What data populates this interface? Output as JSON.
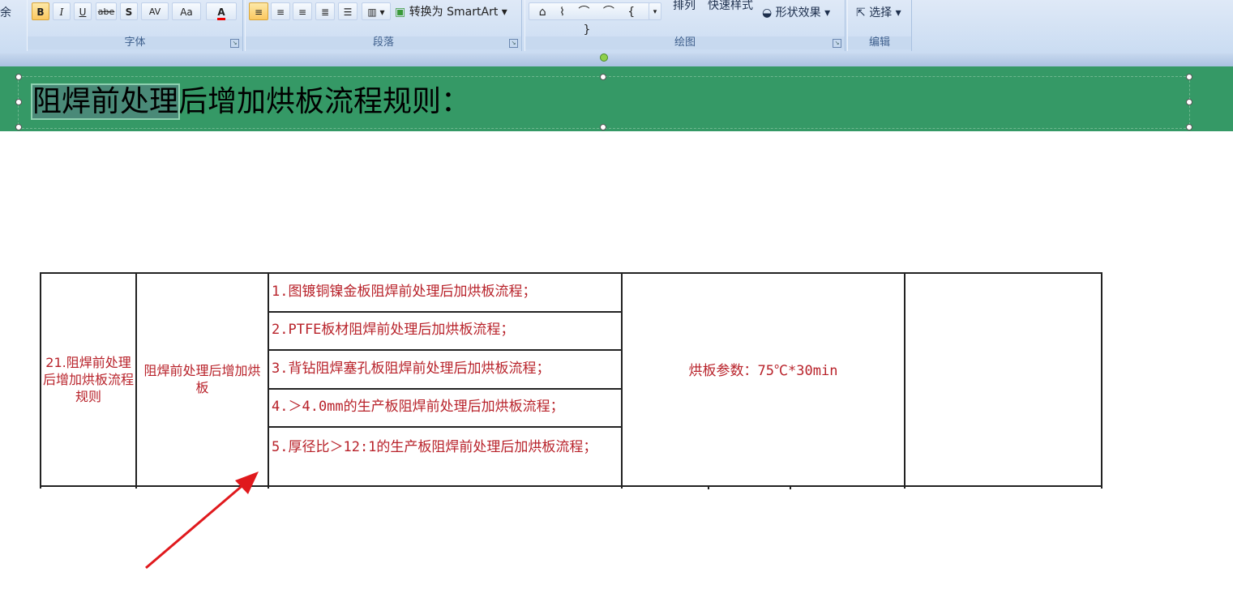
{
  "ribbon": {
    "partial_left": "余",
    "font_group": {
      "label": "字体",
      "bold": "B",
      "italic": "I",
      "underline": "U",
      "strike": "abe",
      "shadow": "S",
      "spacing": "AV",
      "case": "Aa",
      "color_a": "A"
    },
    "paragraph_group": {
      "label": "段落",
      "smartart": "转换为 SmartArt"
    },
    "drawing_group": {
      "label": "绘图",
      "arrange": "排列",
      "quick_styles": "快速样式",
      "shape_effects": "形状效果"
    },
    "edit_group": {
      "label": "编辑",
      "select": "选择"
    }
  },
  "slide": {
    "title_selected": "阻焊前处理",
    "title_rest": "后增加烘板流程规则："
  },
  "table": {
    "col1": "21.阻焊前处理后增加烘板流程规则",
    "col2": "阻焊前处理后增加烘板",
    "items": [
      "1.图镀铜镍金板阻焊前处理后加烘板流程；",
      "2.PTFE板材阻焊前处理后加烘板流程；",
      "3.背钻阻焊塞孔板阻焊前处理后加烘板流程；",
      "4.＞4.0mm的生产板阻焊前处理后加烘板流程；",
      "5.厚径比＞12:1的生产板阻焊前处理后加烘板流程；"
    ],
    "col4": "烘板参数：75℃*30min",
    "col5": ""
  },
  "colors": {
    "accent_red": "#b8222a",
    "title_band": "#359966",
    "arrow": "#e0191d"
  }
}
